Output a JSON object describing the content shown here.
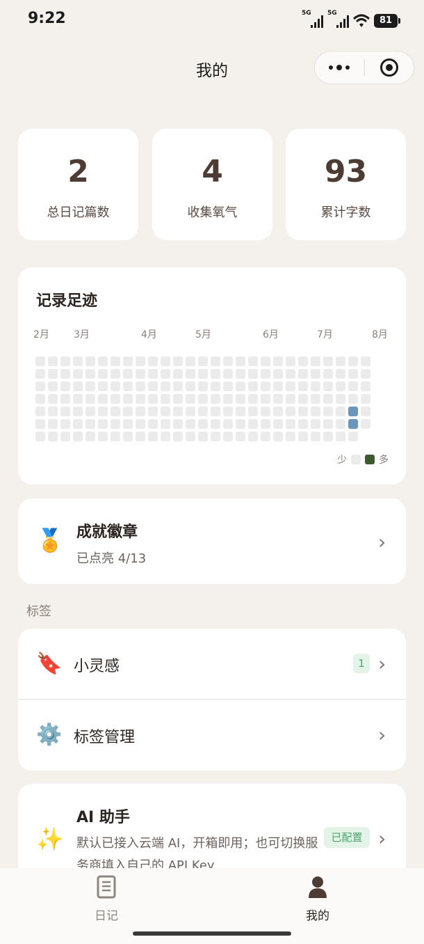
{
  "status_bar": {
    "time": "9:22",
    "signal1": "5G",
    "signal2": "5G",
    "battery": "81"
  },
  "header": {
    "title": "我的"
  },
  "stats": [
    {
      "value": "2",
      "label": "总日记篇数"
    },
    {
      "value": "4",
      "label": "收集氧气"
    },
    {
      "value": "93",
      "label": "累计字数"
    }
  ],
  "footprint": {
    "title": "记录足迹",
    "months": [
      "2月",
      "3月",
      "4月",
      "5月",
      "6月",
      "7月",
      "8月"
    ],
    "legend_less": "少",
    "legend_more": "多",
    "colors": {
      "empty": "#ecebec",
      "active": "#6b96bc",
      "legend_more": "#3f5a2e"
    }
  },
  "achievements": {
    "icon": "medal-icon",
    "title": "成就徽章",
    "subtitle": "已点亮 4/13"
  },
  "tags": {
    "section_label": "标签",
    "items": [
      {
        "icon": "bookmark-icon",
        "label": "小灵感",
        "count": "1"
      },
      {
        "icon": "gear-icon",
        "label": "标签管理"
      }
    ]
  },
  "ai": {
    "icon": "sparkles-icon",
    "title": "AI 助手",
    "description": "默认已接入云端 AI，开箱即用；也可切换服务商填入自己的 API Key",
    "status": "已配置"
  },
  "tabbar": {
    "items": [
      {
        "label": "日记"
      },
      {
        "label": "我的"
      }
    ]
  }
}
